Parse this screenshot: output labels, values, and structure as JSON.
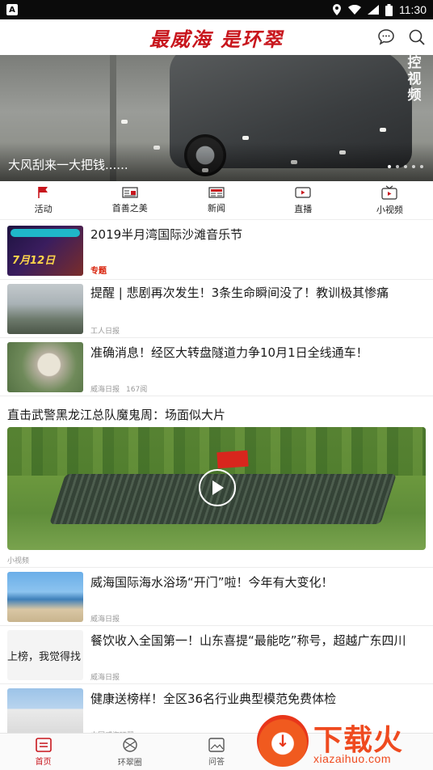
{
  "status_bar": {
    "time": "11:30",
    "left_badge": "A"
  },
  "header": {
    "brand": "最威海 是环翠"
  },
  "banner": {
    "caption": "大风刮来一大把钱......",
    "watermark": "控视频"
  },
  "nav": [
    {
      "label": "活动",
      "icon": "flag-icon"
    },
    {
      "label": "首善之美",
      "icon": "newspaper-icon"
    },
    {
      "label": "新闻",
      "icon": "news-icon"
    },
    {
      "label": "直播",
      "icon": "live-icon"
    },
    {
      "label": "小视频",
      "icon": "tv-icon"
    }
  ],
  "feed": {
    "items": [
      {
        "title": "2019半月湾国际沙滩音乐节",
        "tag": "专题",
        "source": "",
        "views": ""
      },
      {
        "title": "提醒 | 悲剧再次发生！3条生命瞬间没了！教训极其惨痛",
        "tag": "",
        "source": "工人日报",
        "views": ""
      },
      {
        "title": "准确消息！经区大转盘隧道力争10月1日全线通车！",
        "tag": "",
        "source": "威海日报",
        "views": "167阅"
      }
    ],
    "video": {
      "title": "直击武警黑龙江总队魔鬼周：场面似大片",
      "label": "小视频"
    },
    "items2": [
      {
        "title": "威海国际海水浴场“开门”啦！今年有大变化！",
        "source": "威海日报"
      },
      {
        "title": "餐饮收入全国第一！山东喜提“最能吃”称号，超越广东四川",
        "source": "威海日报",
        "thumb_text": "上榜，我觉得找"
      },
      {
        "title": "健康送榜样！全区36名行业典型模范免费体检",
        "source": "中国威海环翠"
      }
    ],
    "thumb1_text": "7月12日"
  },
  "tabbar": [
    {
      "label": "首页",
      "icon": "home-icon"
    },
    {
      "label": "环翠圈",
      "icon": "circle-icon"
    },
    {
      "label": "问答",
      "icon": "image-icon"
    }
  ],
  "promo": {
    "word": "下载火",
    "site": "xiazaihuo.com"
  },
  "colors": {
    "brand_red": "#c8161d",
    "promo_orange": "#ef4a1f"
  }
}
